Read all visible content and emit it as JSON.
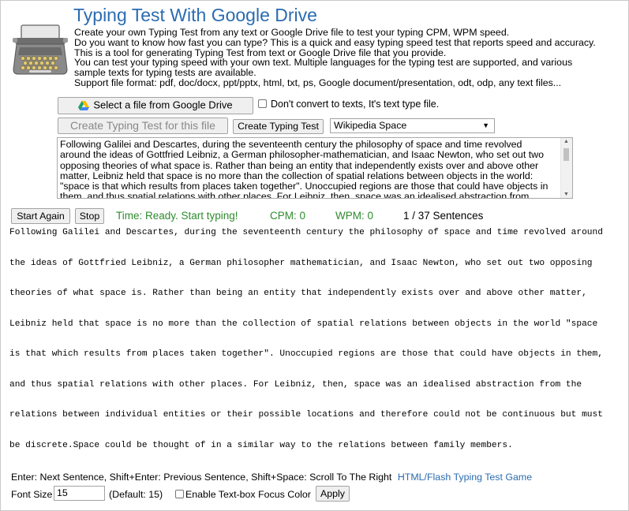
{
  "header": {
    "title": "Typing Test With Google Drive",
    "description_lines": [
      "Create your own Typing Test from any text or Google Drive file to test your typing CPM, WPM speed.",
      "Do you want to know how fast you can type? This is a quick and easy typing speed test that reports speed and accuracy.",
      "This is a tool for generating Typing Test from text or Google Drive file that you provide.",
      "You can test your typing speed with your own text. Multiple languages for the typing test are supported, and various",
      "sample texts for typing tests are available.",
      "Support file format: pdf, doc/docx, ppt/pptx, html, txt, ps, Google document/presentation, odt, odp, any text files..."
    ]
  },
  "controls": {
    "select_file_label": "Select a file from Google Drive",
    "dont_convert_label": "Don't convert to texts, It's text type file.",
    "create_for_file_label": "Create Typing Test for this file",
    "create_label": "Create Typing Test",
    "sample_select_value": "Wikipedia Space"
  },
  "source_text_lines": [
    "Following Galilei and Descartes, during the seventeenth century the philosophy of space and time revolved",
    "around the ideas of Gottfried Leibniz, a German philosopher-mathematician, and Isaac Newton, who set out two",
    "opposing theories of what space is. Rather than being an entity that independently exists over and above other",
    "matter, Leibniz held that space is no more than the collection of spatial relations between objects in the world:",
    "\"space is that which results from places taken together\". Unoccupied regions are those that could have objects in",
    "them, and thus spatial relations with other places. For Leibniz, then, space was an idealised abstraction from"
  ],
  "test_bar": {
    "start_again_label": "Start Again",
    "stop_label": "Stop",
    "time_text": "Time: Ready. Start typing!",
    "cpm_text": "CPM: 0",
    "wpm_text": "WPM: 0",
    "sentences_text": "1 / 37 Sentences"
  },
  "typing_lines": [
    "Following Galilei and Descartes, during the seventeenth century the philosophy of space and time revolved around",
    "the ideas of Gottfried Leibniz, a German philosopher mathematician, and Isaac Newton, who set out two opposing",
    "theories of what space is. Rather than being an entity that independently exists over and above other matter,",
    "Leibniz held that space is no more than the collection of spatial relations between objects in the world \"space",
    "is that which results from places taken together\". Unoccupied regions are those that could have objects in them,",
    "and thus spatial relations with other places. For Leibniz, then, space was an idealised abstraction from the",
    "relations between individual entities or their possible locations and therefore could not be continuous but must",
    "be discrete.Space could be thought of in a similar way to the relations between family members."
  ],
  "footer": {
    "help_text": "Enter: Next Sentence, Shift+Enter: Previous Sentence, Shift+Space: Scroll To The Right",
    "link_text": "HTML/Flash Typing Test Game",
    "font_size_label": "Font Size",
    "font_size_value": "15",
    "default_text": "(Default: 15)",
    "focus_color_label": "Enable Text-box Focus Color",
    "apply_label": "Apply"
  },
  "colors": {
    "title": "#2b6cb0",
    "status_green": "#2e8b2e",
    "link": "#2b6cb0"
  },
  "icons": [
    "typewriter-logo",
    "google-drive-icon",
    "select-arrow-icon",
    "scroll-up-icon",
    "scroll-down-icon"
  ]
}
